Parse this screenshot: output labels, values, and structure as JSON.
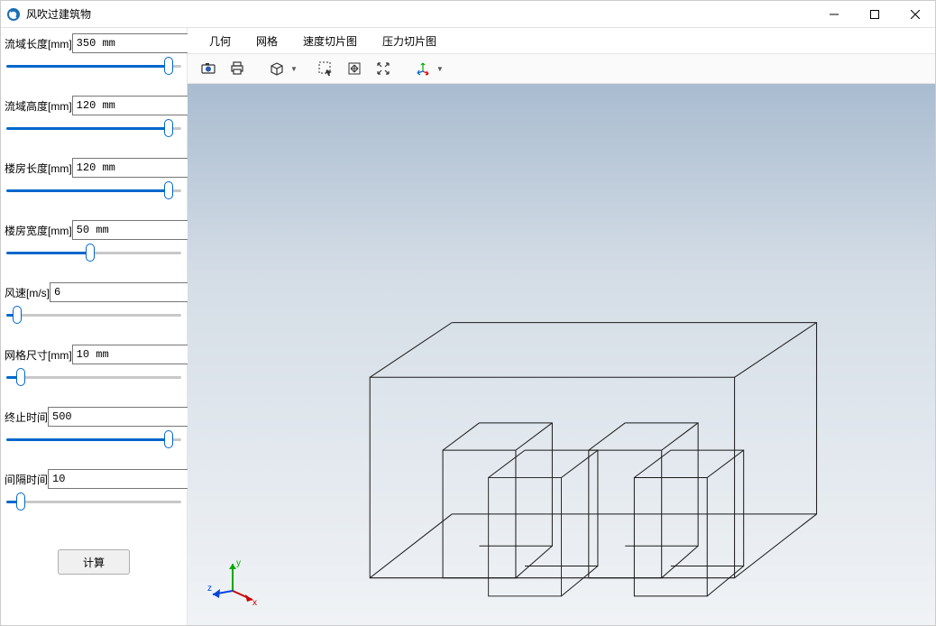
{
  "window": {
    "title": "风吹过建筑物"
  },
  "params": [
    {
      "label": "流域长度[mm]",
      "value": "350 mm",
      "slider": 95
    },
    {
      "label": "流域高度[mm]",
      "value": "120 mm",
      "slider": 95
    },
    {
      "label": "楼房长度[mm]",
      "value": "120 mm",
      "slider": 95
    },
    {
      "label": "楼房宽度[mm]",
      "value": "50 mm",
      "slider": 48
    },
    {
      "label": "风速[m/s]",
      "value": "6",
      "slider": 4
    },
    {
      "label": "网格尺寸[mm]",
      "value": "10 mm",
      "slider": 6
    },
    {
      "label": "终止时间",
      "value": "500",
      "slider": 95
    },
    {
      "label": "间隔时间",
      "value": "10",
      "slider": 6
    }
  ],
  "compute_label": "计算",
  "tabs": [
    "几何",
    "网格",
    "速度切片图",
    "压力切片图"
  ],
  "toolbar_icons": [
    "camera-icon",
    "print-icon",
    "box-view-icon",
    "select-icon",
    "pan-icon",
    "fit-icon",
    "axis-icon"
  ],
  "axis_labels": {
    "x": "x",
    "y": "y",
    "z": "z"
  }
}
